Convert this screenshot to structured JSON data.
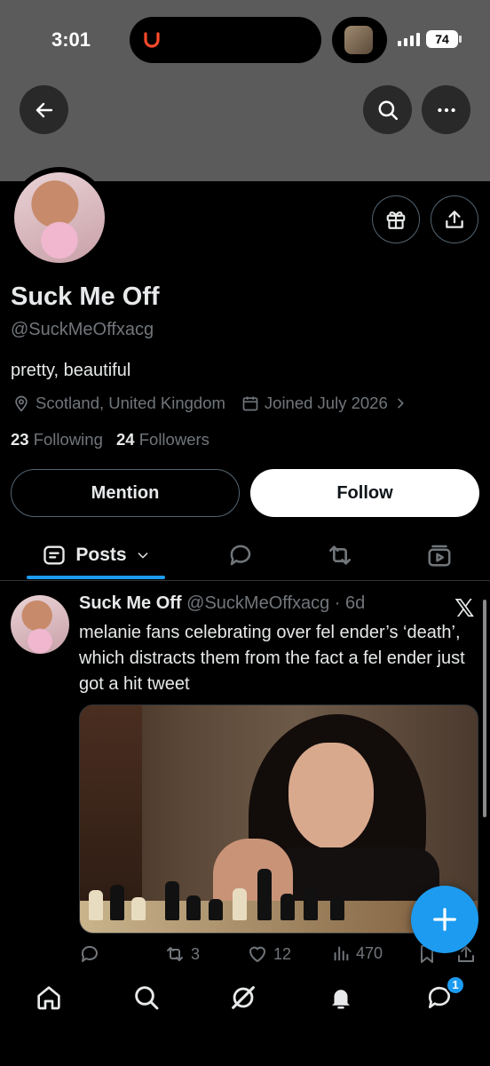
{
  "status_bar": {
    "time": "3:01",
    "battery": "74"
  },
  "profile": {
    "display_name": "Suck Me Off",
    "handle": "@SuckMeOffxacg",
    "bio": "pretty, beautiful",
    "location": "Scotland, United Kingdom",
    "joined": "Joined July 2026",
    "following_count": "23",
    "following_label": "Following",
    "followers_count": "24",
    "followers_label": "Followers",
    "mention_label": "Mention",
    "follow_label": "Follow"
  },
  "tabs": {
    "posts_label": "Posts"
  },
  "tweet": {
    "name": "Suck Me Off",
    "handle_time": "@SuckMeOffxacg · 6d",
    "text": "melanie fans celebrating over fel ender’s ‘death’, which distracts them from the fact a fel ender just got a hit tweet",
    "replies": "",
    "retweets": "3",
    "likes": "12",
    "views": "470"
  },
  "nav": {
    "messages_badge": "1"
  },
  "colors": {
    "accent": "#1d9bf0",
    "banner": "#5b5b5b",
    "muted": "#71767b"
  },
  "icons": [
    "back-arrow-icon",
    "search-icon",
    "more-icon",
    "gift-icon",
    "share-icon",
    "location-icon",
    "calendar-icon",
    "posts-icon",
    "replies-icon",
    "reposts-icon",
    "media-icon",
    "x-logo-icon",
    "reply-icon",
    "retweet-icon",
    "like-icon",
    "views-icon",
    "bookmark-icon",
    "upload-icon",
    "compose-plus-icon",
    "home-icon",
    "explore-icon",
    "grok-icon",
    "notifications-icon",
    "messages-icon"
  ]
}
